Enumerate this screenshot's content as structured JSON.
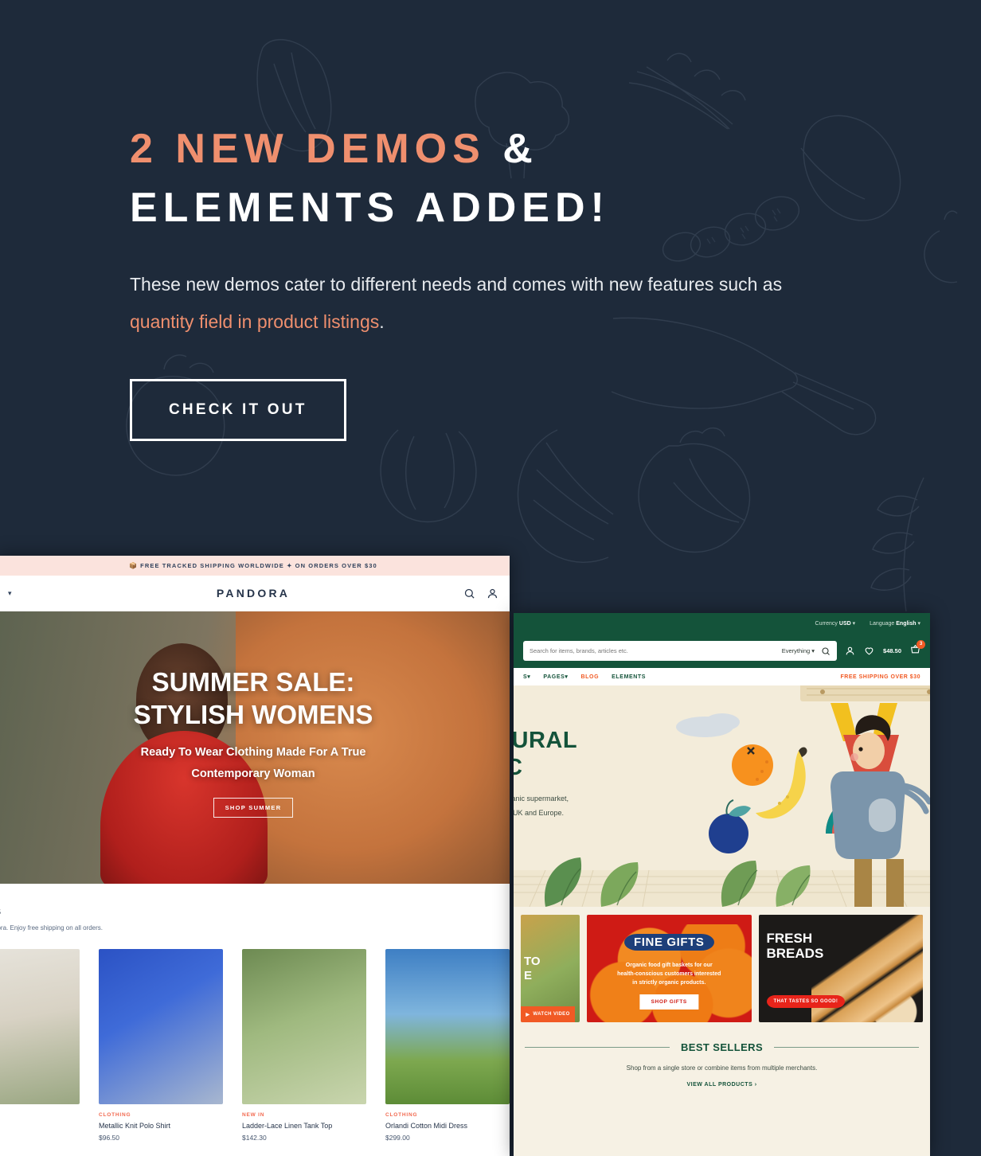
{
  "promo": {
    "heading_line1_accent": "2 NEW DEMOS",
    "heading_line1_rest": " &",
    "heading_line2": "ELEMENTS ADDED!",
    "sub_part1": "These new demos cater to different needs and comes with new features such as ",
    "sub_accent": "quantity field in product listings",
    "sub_part2": ".",
    "cta_label": "CHECK IT OUT",
    "accent_color": "#ef8f6e",
    "background_color": "#1e2a3a"
  },
  "pandora": {
    "topbar": {
      "icon": "package-icon",
      "text": "FREE TRACKED SHIPPING WORLDWIDE ✦ ON ORDERS OVER $30"
    },
    "header": {
      "nav_chevron": "▾",
      "logo": "PANDORA",
      "icons": [
        "search-icon",
        "account-icon"
      ]
    },
    "hero": {
      "title_line1": "SUMMER SALE:",
      "title_line2": "STYLISH WOMENS",
      "sub_line1": "Ready To Wear Clothing Made For A True",
      "sub_line2": "Contemporary Woman",
      "button_label": "SHOP SUMMER"
    },
    "section": {
      "title": "Sellers",
      "subtitle": "llers at Pandora. Enjoy free shipping on all orders."
    },
    "products": [
      {
        "category": "",
        "name": "",
        "price": ""
      },
      {
        "category": "CLOTHING",
        "name": "Metallic Knit Polo Shirt",
        "price": "$96.50"
      },
      {
        "category": "NEW IN",
        "name": "Ladder-Lace Linen Tank Top",
        "price": "$142.30"
      },
      {
        "category": "CLOTHING",
        "name": "Orlandi Cotton Midi Dress",
        "price": "$299.00"
      }
    ],
    "category_color": "#f2694f"
  },
  "organic": {
    "topbar": {
      "currency_label": "Currency",
      "currency_value": "USD",
      "currency_chevron": "▾",
      "language_label": "Language",
      "language_value": "English",
      "language_chevron": "▾"
    },
    "search": {
      "placeholder": "Search for items, brands, articles etc.",
      "scope": "Everything",
      "scope_chevron": "▾",
      "search_icon": "search-icon"
    },
    "actions": {
      "account_icon": "account-icon",
      "wishlist_icon": "heart-icon",
      "cart_total": "$48.50",
      "cart_icon": "basket-icon",
      "cart_badge": "3"
    },
    "nav": {
      "items": [
        {
          "label": "S",
          "chevron": "▾",
          "hot": false
        },
        {
          "label": "PAGES",
          "chevron": "▾",
          "hot": false
        },
        {
          "label": "BLOG",
          "chevron": "",
          "hot": true
        },
        {
          "label": "ELEMENTS",
          "chevron": "",
          "hot": false
        }
      ],
      "promo": "FREE SHIPPING OVER $30"
    },
    "hero": {
      "title_line1": "ATURAL",
      "title_line2": "NIC",
      "sub_line1": "rtified organic supermarket,",
      "sub_line2": "cross the UK and Europe."
    },
    "promos": {
      "video": {
        "text_line1": "TO",
        "text_line2": "E",
        "button_label": "WATCH VIDEO",
        "play_icon": "play-icon"
      },
      "gifts": {
        "title": "FINE GIFTS",
        "desc_line1": "Organic food gift baskets for our",
        "desc_line2": "health-conscious customers interested",
        "desc_line3": "in strictly organic products.",
        "button_label": "SHOP GIFTS"
      },
      "bread": {
        "title_line1": "FRESH",
        "title_line2": "BREADS",
        "tag": "THAT TASTES SO GOOD!"
      }
    },
    "best": {
      "title": "BEST SELLERS",
      "subtitle": "Shop from a single store or combine items from multiple merchants.",
      "link_label": "VIEW ALL PRODUCTS",
      "link_chevron": "›"
    },
    "brand_color": "#14533a",
    "accent_color": "#f15a24"
  }
}
